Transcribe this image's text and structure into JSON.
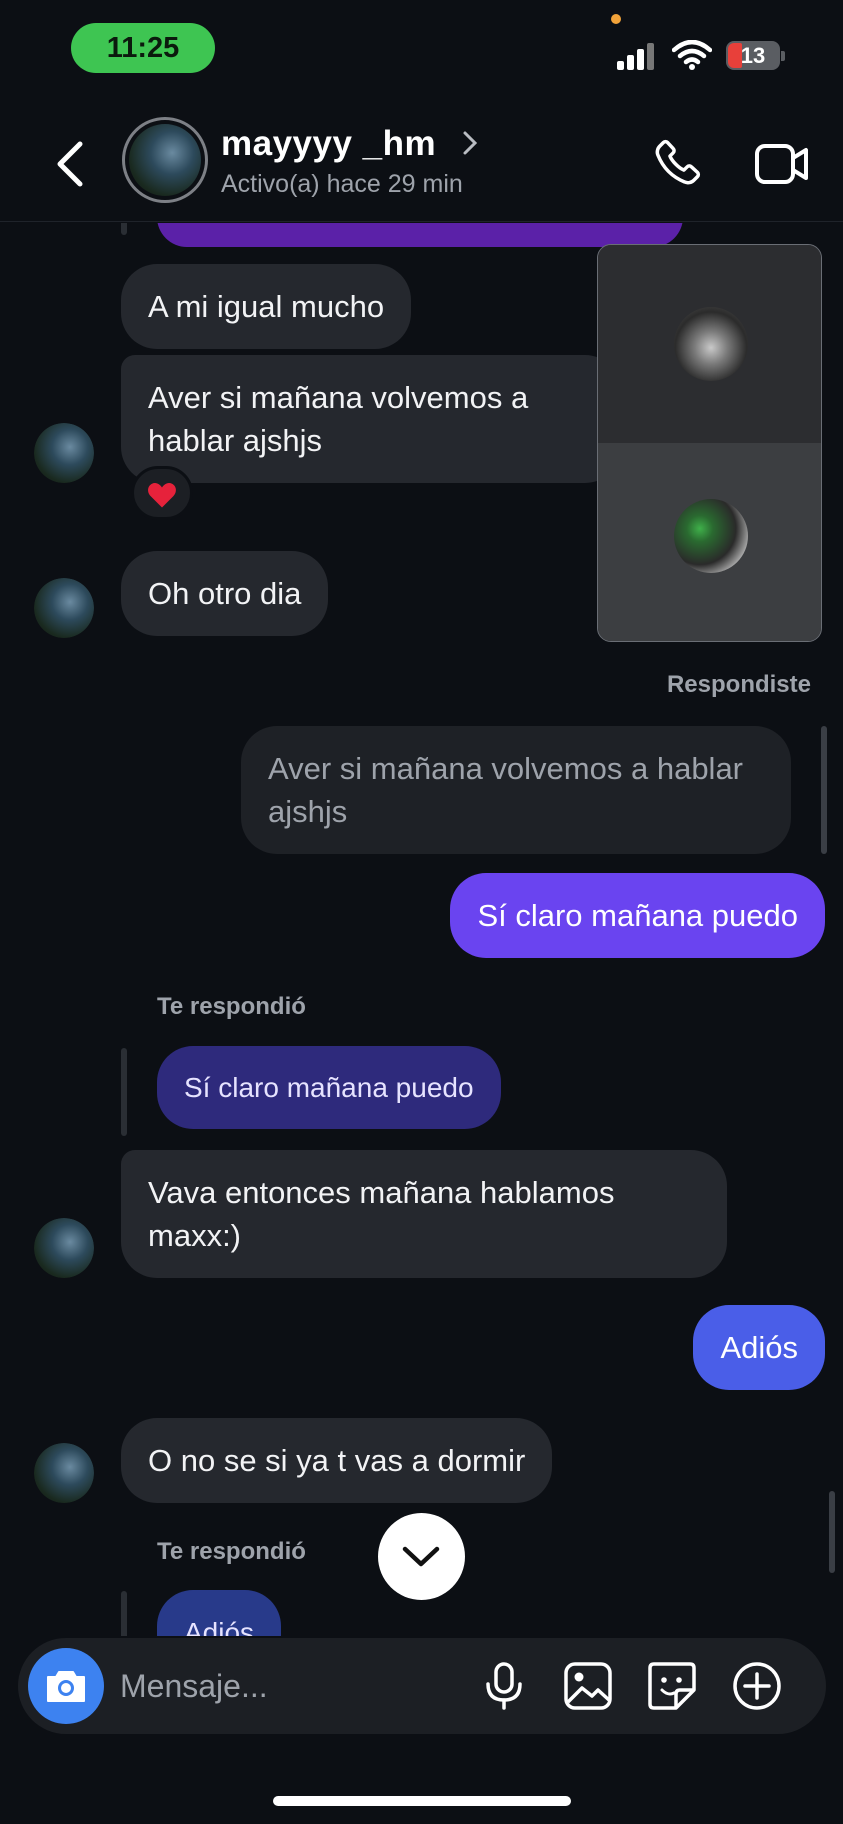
{
  "status_bar": {
    "time": "11:25",
    "battery": "13"
  },
  "header": {
    "contact_name": "mayyyy _hm",
    "contact_status": "Activo(a) hace 29 min"
  },
  "messages": {
    "m1": "A mi igual mucho",
    "m2": "Aver si mañana volvemos a hablar ajshjs",
    "m2_reaction": "❤️",
    "m3": "Oh otro dia",
    "replied_label": "Respondiste",
    "reply_quote_1": "Aver si mañana volvemos a hablar ajshjs",
    "m4": "Sí claro mañana puedo",
    "te_respondio_1": "Te respondió",
    "reply_quote_2": "Sí claro mañana puedo",
    "m5": "Vava entonces mañana hablamos maxx:)",
    "m6": "Adiós",
    "m7": "O no se si ya t vas a dormir",
    "te_respondio_2": "Te respondió",
    "reply_quote_3": "Adiós"
  },
  "composer": {
    "placeholder": "Mensaje..."
  },
  "colors": {
    "outgoing": "#6a44f0",
    "outgoing_blue": "#4a5ee8",
    "incoming": "#25282e",
    "background": "#0c0f14",
    "time_pill": "#3ec552"
  }
}
